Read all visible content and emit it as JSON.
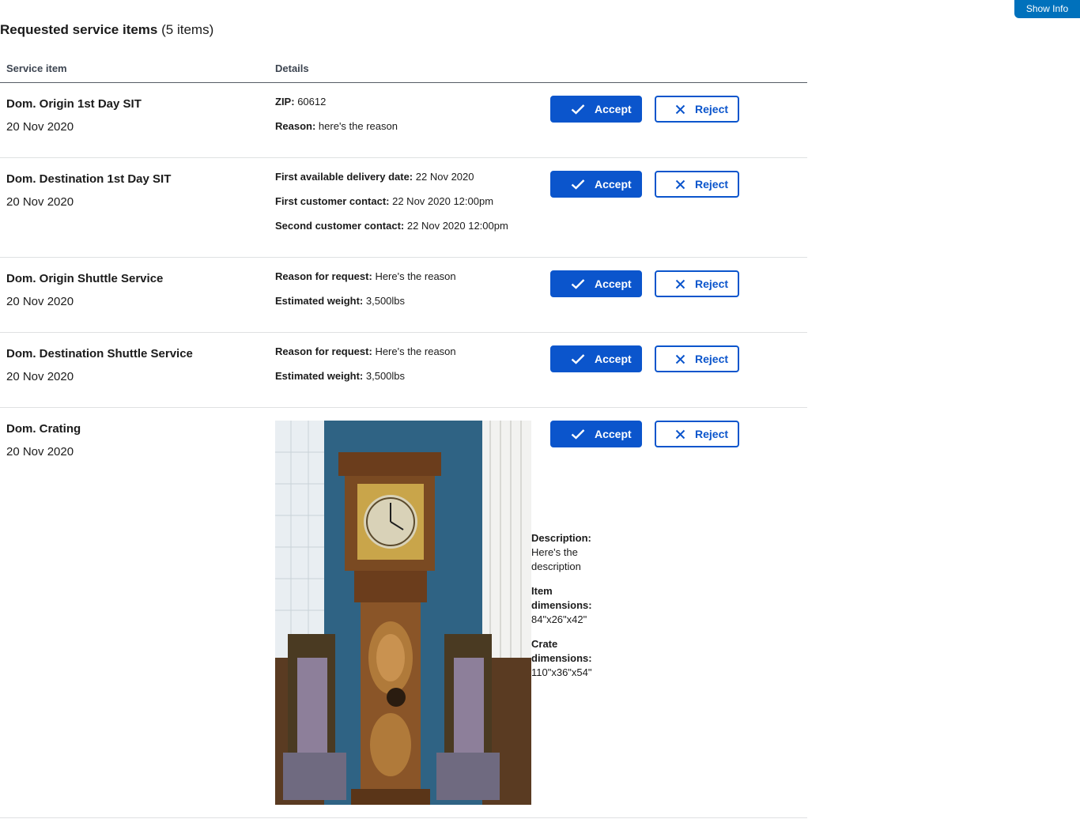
{
  "header": {
    "show_info_label": "Show Info",
    "title": "Requested service items",
    "count": "(5 items)"
  },
  "table": {
    "columns": [
      "Service item",
      "Details"
    ],
    "accept_label": "Accept",
    "reject_label": "Reject",
    "rows": [
      {
        "name": "Dom. Origin 1st Day SIT",
        "date": "20 Nov 2020",
        "details": [
          {
            "label": "ZIP:",
            "value": "60612"
          },
          {
            "label": "Reason:",
            "value": "here's the reason"
          }
        ]
      },
      {
        "name": "Dom. Destination 1st Day SIT",
        "date": "20 Nov 2020",
        "details": [
          {
            "label": "First available delivery date:",
            "value": "22 Nov 2020"
          },
          {
            "label": "First customer contact:",
            "value": "22 Nov 2020 12:00pm"
          },
          {
            "label": "Second customer contact:",
            "value": "22 Nov 2020 12:00pm"
          }
        ]
      },
      {
        "name": "Dom. Origin Shuttle Service",
        "date": "20 Nov 2020",
        "details": [
          {
            "label": "Reason for request:",
            "value": "Here's the reason"
          },
          {
            "label": "Estimated weight:",
            "value": "3,500lbs"
          }
        ]
      },
      {
        "name": "Dom. Destination Shuttle Service",
        "date": "20 Nov 2020",
        "details": [
          {
            "label": "Reason for request:",
            "value": "Here's the reason"
          },
          {
            "label": "Estimated weight:",
            "value": "3,500lbs"
          }
        ]
      },
      {
        "name": "Dom. Crating",
        "date": "20 Nov 2020",
        "details": [
          {
            "label": "Description:",
            "value": "Here's the description"
          },
          {
            "label": "Item dimensions:",
            "value": "84\"x26\"x42\""
          },
          {
            "label": "Crate dimensions:",
            "value": "110\"x36\"x54\""
          }
        ]
      }
    ]
  },
  "colors": {
    "primary": "#0b55cc",
    "show_info_bg": "#0071bc"
  },
  "icons": {
    "accept": "check-icon",
    "reject": "close-icon"
  }
}
